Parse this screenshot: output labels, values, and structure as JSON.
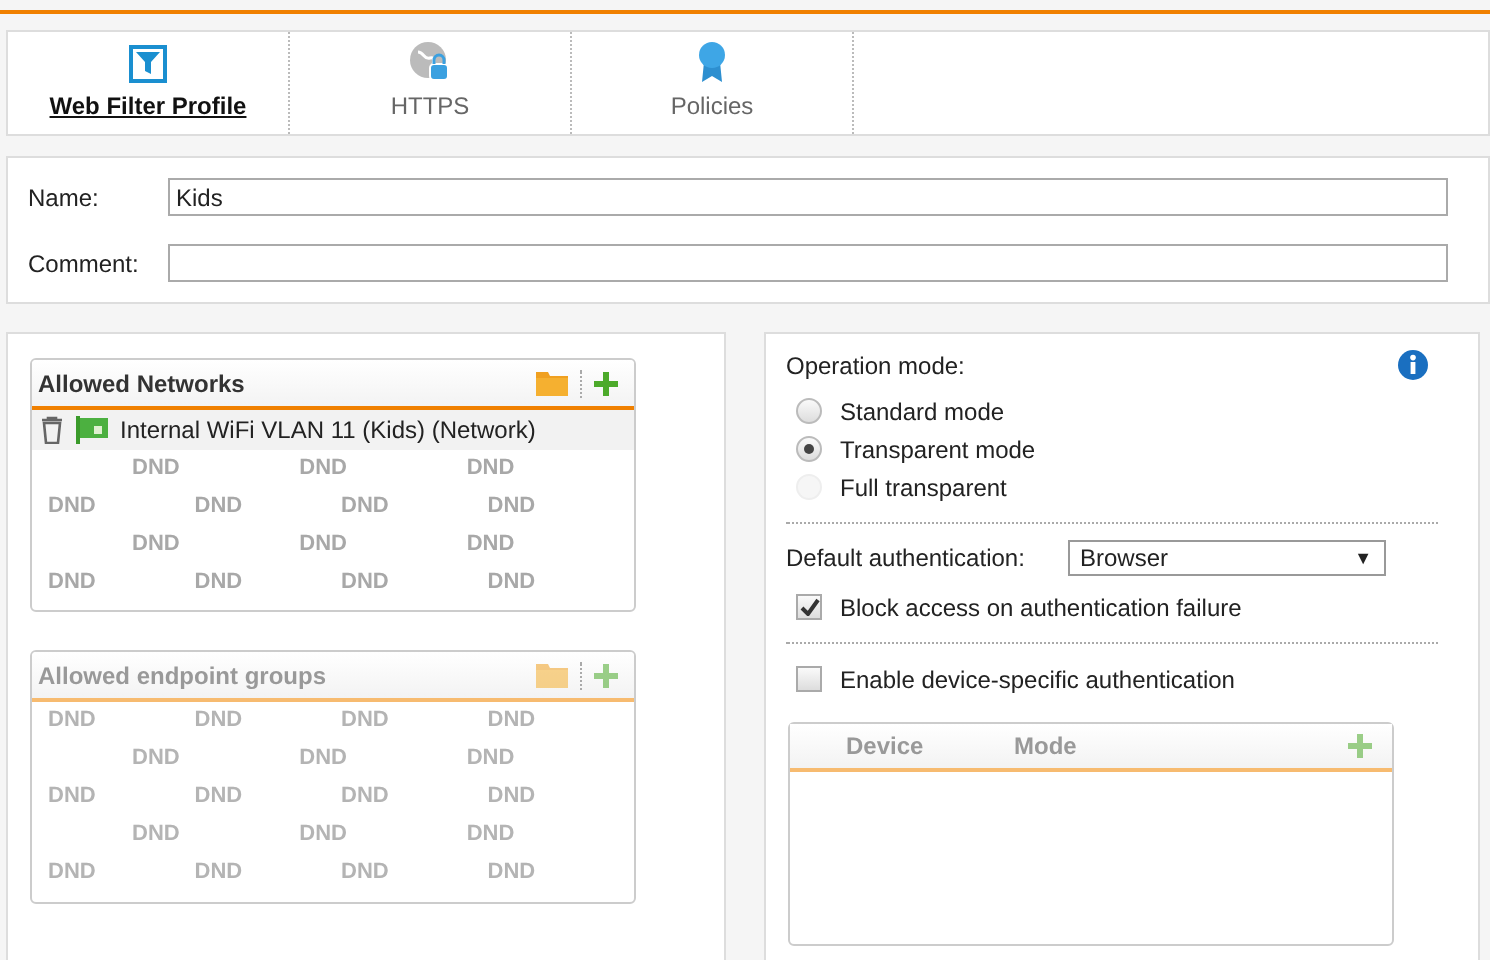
{
  "tabs": [
    {
      "label": "Web Filter Profile",
      "selected": true
    },
    {
      "label": "HTTPS",
      "selected": false
    },
    {
      "label": "Policies",
      "selected": false
    }
  ],
  "form": {
    "name": {
      "label": "Name:",
      "value": "Kids"
    },
    "comment": {
      "label": "Comment:"
    }
  },
  "lists": [
    {
      "title": "Allowed Networks",
      "disabled": false,
      "items": [
        {
          "label": "Internal WiFi VLAN 11 (Kids) (Network)"
        }
      ],
      "watermark_rows": [
        [
          "DND",
          "DND",
          "DND"
        ],
        [
          "DND",
          "DND",
          "DND",
          "DND"
        ],
        [
          "DND",
          "DND",
          "DND"
        ],
        [
          "DND",
          "DND",
          "DND",
          "DND"
        ]
      ]
    },
    {
      "title": "Allowed endpoint groups",
      "disabled": true,
      "watermark_rows": [
        [
          "DND",
          "DND",
          "DND",
          "DND"
        ],
        [
          "DND",
          "DND",
          "DND"
        ],
        [
          "DND",
          "DND",
          "DND",
          "DND"
        ],
        [
          "DND",
          "DND",
          "DND"
        ],
        [
          "DND",
          "DND",
          "DND",
          "DND"
        ]
      ]
    }
  ],
  "operation_mode": {
    "label": "Operation mode:",
    "options": [
      {
        "label": "Standard mode",
        "selected": false,
        "disabled": false
      },
      {
        "label": "Transparent mode",
        "selected": true,
        "disabled": false
      },
      {
        "label": "Full transparent",
        "selected": false,
        "disabled": true
      }
    ]
  },
  "default_authentication": {
    "label": "Default authentication:",
    "value": "Browser",
    "caret": "▼"
  },
  "checkboxes": [
    {
      "label": "Block access on authentication failure",
      "checked": true
    },
    {
      "label": "Enable device-specific authentication",
      "checked": false
    }
  ],
  "device_table": {
    "columns": [
      "Device",
      "Mode"
    ],
    "disabled": true
  }
}
